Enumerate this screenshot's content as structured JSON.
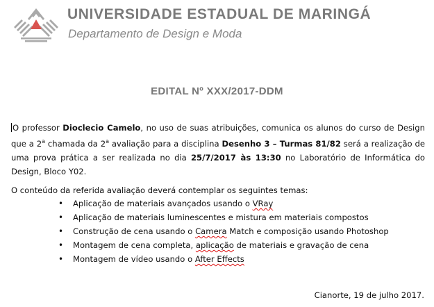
{
  "letterhead": {
    "university": "UNIVERSIDADE ESTADUAL DE MARINGÁ",
    "department": "Departamento de Design e Moda",
    "logo_icon": "uem-logo-icon",
    "logo_color_gray": "#a9a9a9",
    "logo_color_red": "#d9534f"
  },
  "document": {
    "title": "EDITAL Nº XXX/2017-DDM",
    "para1": {
      "t1": "O professor ",
      "b1": "Dioclecio Camelo",
      "t2": ", no uso de suas atribuições, comunica os alunos do curso de Design que a 2",
      "sup1": "a",
      "t3": " chamada da 2",
      "sup2": "a",
      "t4": " avaliação para a disciplina ",
      "b2": "Desenho 3 – Turmas 81/82",
      "t5": " será a realização de uma prova prática a ser realizada no dia ",
      "b3": "25/7/2017 às 13:30",
      "t6": " no Laboratório de Informática do Design, Bloco Y02."
    },
    "para2": "O conteúdo da referida avaliação deverá contemplar os seguintes temas:",
    "topics": [
      {
        "pre": "Aplicação de materiais avançados usando o ",
        "mark": "VRay",
        "post": ""
      },
      {
        "pre": "Aplicação de materiais luminescentes e mistura em materiais compostos",
        "mark": "",
        "post": ""
      },
      {
        "pre": "Construção de cena usando o ",
        "mark": "Camera",
        "post": " Match e composição usando Photoshop"
      },
      {
        "pre": "Montagem de cena completa, ",
        "mark": "aplicação",
        "post": " de materiais e gravação de cena"
      },
      {
        "pre": "Montagem de vídeo usando o ",
        "mark": "After Effects",
        "post": ""
      }
    ],
    "signature": "Cianorte, 19 de julho 2017."
  }
}
